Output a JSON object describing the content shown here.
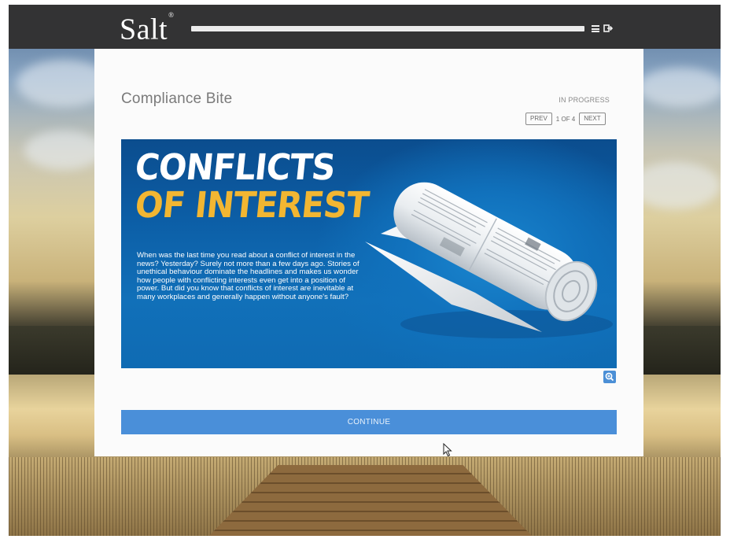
{
  "header": {
    "logo_text": "Salt",
    "logo_mark": "®",
    "menu_icon": "menu-icon",
    "exit_icon": "exit-icon"
  },
  "module": {
    "title": "Compliance Bite",
    "status": "IN PROGRESS",
    "prev_label": "PREV",
    "page_indicator": "1 OF 4",
    "next_label": "NEXT"
  },
  "slide": {
    "heading_line1": "CONFLICTS",
    "heading_line2": "OF INTEREST",
    "body": "When was the last time you read about a conflict of interest in the news? Yesterday? Surely not more than a few days ago. Stories of unethical behaviour dominate the headlines and makes us wonder how people with conflicting interests even get into a position of power. But did you know that conflicts of interest are inevitable at many workplaces and generally happen without anyone's fault?",
    "image": "rolled-newspaper",
    "zoom_icon": "zoom-icon"
  },
  "actions": {
    "continue_label": "CONTINUE"
  },
  "colors": {
    "topbar": "#333334",
    "accent": "#4a8fd9",
    "hero_blue": "#0f6bb3",
    "heading_yellow": "#f2b632"
  }
}
